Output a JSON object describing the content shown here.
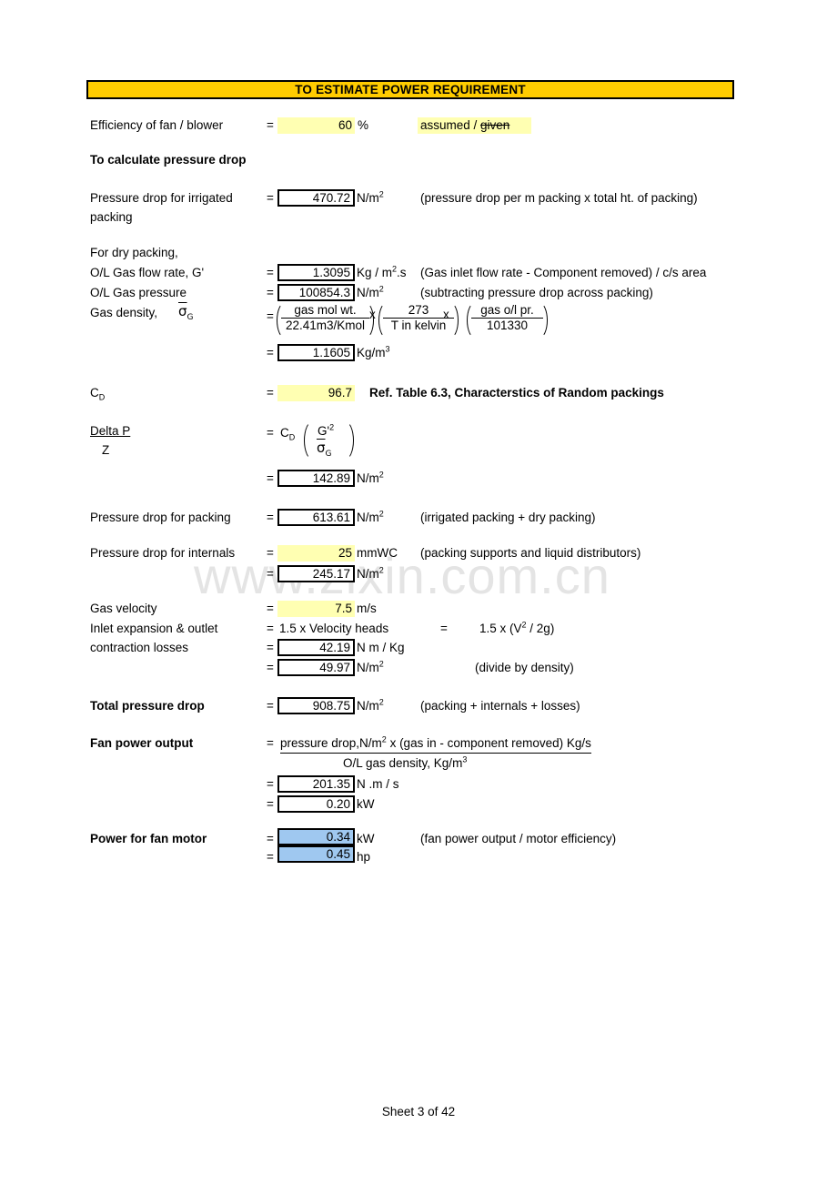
{
  "banner": {
    "title": "TO ESTIMATE POWER REQUIREMENT"
  },
  "efficiency": {
    "label": "Efficiency of fan / blower",
    "eq": "=",
    "value": "60",
    "unit": "%",
    "note_assumed": "assumed /",
    "note_given": "given"
  },
  "section_pressure_drop": {
    "heading": "To calculate pressure drop"
  },
  "irrigated": {
    "label_line1": "Pressure drop for irrigated",
    "label_line2": "packing",
    "eq": "=",
    "value": "470.72",
    "unit": "N/m",
    "unit_sup": "2",
    "note": "(pressure drop per m packing  x total ht. of packing)"
  },
  "dry_packing": {
    "heading": "For dry packing,",
    "gas_flow": {
      "label": "O/L Gas flow rate, G'",
      "eq": "=",
      "value": "1.3095",
      "unit_pre": "Kg / m",
      "unit_sup": "2",
      "unit_post": ".s",
      "note": "(Gas inlet flow rate - Component removed) / c/s area"
    },
    "gas_pressure": {
      "label": "O/L Gas pressure",
      "eq": "=",
      "value": "100854.3",
      "unit": "N/m",
      "unit_sup": "2",
      "note": "(subtracting pressure drop across packing)"
    },
    "gas_density": {
      "label": "Gas density,",
      "symbol": "σ",
      "symbol_sub": "G",
      "eq1": "=",
      "frac1_num": "gas mol wt.",
      "frac1_den": "22.41m3/Kmol",
      "mult1": "x",
      "frac2_num": "273",
      "frac2_den": "T in kelvin",
      "mult2": "x",
      "frac3_num": "gas o/l pr.",
      "frac3_den": "101330",
      "eq2": "=",
      "value": "1.1605",
      "unit": "Kg/m",
      "unit_sup": "3"
    }
  },
  "cd": {
    "label": "C",
    "label_sub": "D",
    "eq": "=",
    "value": "96.7",
    "note": "Ref. Table 6.3, Characterstics of Random packings"
  },
  "delta_p": {
    "num": "Delta P",
    "den": "Z",
    "eq1": "=",
    "cd_label": "C",
    "cd_sub": "D",
    "frac_num": "G'",
    "frac_num_sup": "2",
    "frac_den_sym": "σ",
    "frac_den_sub": "G",
    "eq2": "=",
    "value": "142.89",
    "unit": "N/m",
    "unit_sup": "2"
  },
  "packing_drop": {
    "label": "Pressure drop for packing",
    "eq": "=",
    "value": "613.61",
    "unit": "N/m",
    "unit_sup": "2",
    "note": "(irrigated packing + dry packing)"
  },
  "internals": {
    "label": "Pressure drop for internals",
    "eq1": "=",
    "value1": "25",
    "unit1": "mmWC",
    "note": "(packing supports and liquid distributors)",
    "eq2": "=",
    "value2": "245.17",
    "unit2": "N/m",
    "unit2_sup": "2"
  },
  "gas_velocity": {
    "label": "Gas velocity",
    "eq": "=",
    "value": "7.5",
    "unit": "m/s"
  },
  "losses": {
    "label_line1": "Inlet expansion & outlet",
    "label_line2": "contraction losses",
    "eq1": "=",
    "expr1": "1.5 x Velocity heads",
    "eq_mid": "=",
    "expr2_pre": "1.5 x (V",
    "expr2_sup": "2",
    "expr2_post": " / 2g)",
    "eq2": "=",
    "value1": "42.19",
    "unit1": "N m / Kg",
    "eq3": "=",
    "value2": "49.97",
    "unit2": "N/m",
    "unit2_sup": "2",
    "note": "(divide by density)"
  },
  "total": {
    "label": "Total pressure drop",
    "eq": "=",
    "value": "908.75",
    "unit": "N/m",
    "unit_sup": "2",
    "note": "(packing + internals + losses)"
  },
  "fan_power": {
    "label": "Fan power output",
    "eq1": "=",
    "num_pre": "pressure drop,N/m",
    "num_sup": "2",
    "num_post": " x (gas in - component removed) Kg/s",
    "den_pre": "O/L gas density, Kg/m",
    "den_sup": "3",
    "eq2": "=",
    "value1": "201.35",
    "unit1": "N .m / s",
    "eq3": "=",
    "value2": "0.20",
    "unit2": "kW"
  },
  "motor_power": {
    "label": "Power for fan motor",
    "eq1": "=",
    "value1": "0.34",
    "unit1": "kW",
    "note": "(fan power output / motor efficiency)",
    "eq2": "=",
    "value2": "0.45",
    "unit2": "hp"
  },
  "footer": {
    "text": "Sheet 3 of 42"
  },
  "watermark": {
    "text": "www.zixin.com.cn"
  },
  "colors": {
    "banner_yellow": "#ffcc00",
    "highlight_yellow": "#ffffb2",
    "result_blue": "#9fc8f0",
    "border_black": "#000000"
  }
}
